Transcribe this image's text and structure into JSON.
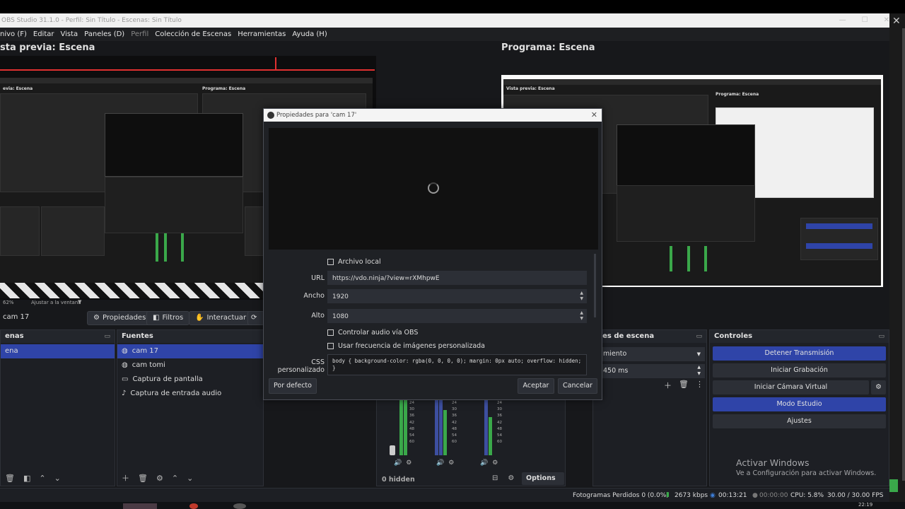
{
  "window": {
    "title": "OBS Studio 31.1.0 - Perfil: Sin Título - Escenas: Sin Título"
  },
  "menu": [
    {
      "label": "nivo (F)",
      "disabled": false
    },
    {
      "label": "Editar",
      "disabled": false
    },
    {
      "label": "Vista",
      "disabled": false
    },
    {
      "label": "Paneles (D)",
      "disabled": false
    },
    {
      "label": "Perfil",
      "disabled": true
    },
    {
      "label": "Colección de Escenas",
      "disabled": false
    },
    {
      "label": "Herramientas",
      "disabled": false
    },
    {
      "label": "Ayuda (H)",
      "disabled": false
    }
  ],
  "preview": {
    "title": "sta previa: Escena",
    "mini_left_title": "evia: Escena",
    "mini_right_title": "Programa: Escena",
    "zoom": "62%",
    "zoom_option": "Ajustar a la ventana"
  },
  "program": {
    "title": "Programa: Escena",
    "mini_left_title": "Vista previa: Escena",
    "mini_right_title": "Programa: Escena"
  },
  "source_bar": {
    "selected_source": "cam 17",
    "properties_label": "Propiedades",
    "filters_label": "Filtros",
    "interact_label": "Interactuar"
  },
  "scenes_dock": {
    "title": "enas",
    "items": [
      "ena"
    ]
  },
  "sources_dock": {
    "title": "Fuentes",
    "items": [
      {
        "label": "cam 17",
        "icon": "globe-icon",
        "selected": true
      },
      {
        "label": "cam tomi",
        "icon": "globe-icon",
        "selected": false
      },
      {
        "label": "Captura de pantalla",
        "icon": "monitor-icon",
        "selected": false
      },
      {
        "label": "Captura de entrada audio",
        "icon": "microphone-icon",
        "selected": false
      }
    ]
  },
  "mixer": {
    "hidden_label": "0 hidden",
    "options_label": "Options",
    "scale": [
      "24",
      "30",
      "36",
      "42",
      "48",
      "54",
      "60"
    ]
  },
  "transitions_dock": {
    "title": "nes de escena",
    "transition": "miento",
    "duration": "450 ms"
  },
  "controls_dock": {
    "title": "Controles",
    "buttons": [
      {
        "label": "Detener Transmisión",
        "active": true
      },
      {
        "label": "Iniciar Grabación",
        "active": false
      },
      {
        "label": "Iniciar Cámara Virtual",
        "active": false
      },
      {
        "label": "Modo Estudio",
        "active": true
      },
      {
        "label": "Ajustes",
        "active": false
      }
    ]
  },
  "status": {
    "dropped_frames": "Fotogramas Perdidos 0 (0.0%)",
    "bitrate": "2673 kbps",
    "stream_time": "00:13:21",
    "rec_time": "00:00:00",
    "cpu": "CPU: 5.8%",
    "fps": "30.00 / 30.00 FPS"
  },
  "watermark": {
    "title": "Activar Windows",
    "subtitle": "Ve a Configuración para activar Windows."
  },
  "taskbar": {
    "clock": "22:19"
  },
  "dialog": {
    "title": "Propiedades para 'cam 17'",
    "local_file_label": "Archivo local",
    "local_file_checked": false,
    "url_label": "URL",
    "url_value": "https://vdo.ninja/?view=rXMhpwE",
    "width_label": "Ancho",
    "width_value": "1920",
    "height_label": "Alto",
    "height_value": "1080",
    "control_audio_label": "Controlar audio vía OBS",
    "control_audio_checked": false,
    "custom_fps_label": "Usar frecuencia de imágenes personalizada",
    "custom_fps_checked": false,
    "css_label": "CSS personalizado",
    "css_value": "body { background-color: rgba(0, 0, 0, 0); margin: 0px auto; overflow: hidden; }",
    "defaults_label": "Por defecto",
    "accept_label": "Aceptar",
    "cancel_label": "Cancelar"
  },
  "colors": {
    "accent": "#2f44a8",
    "background": "#17181b",
    "dock": "#1d1f24",
    "meter_green": "#3aa84a",
    "red_line": "#e03030"
  }
}
